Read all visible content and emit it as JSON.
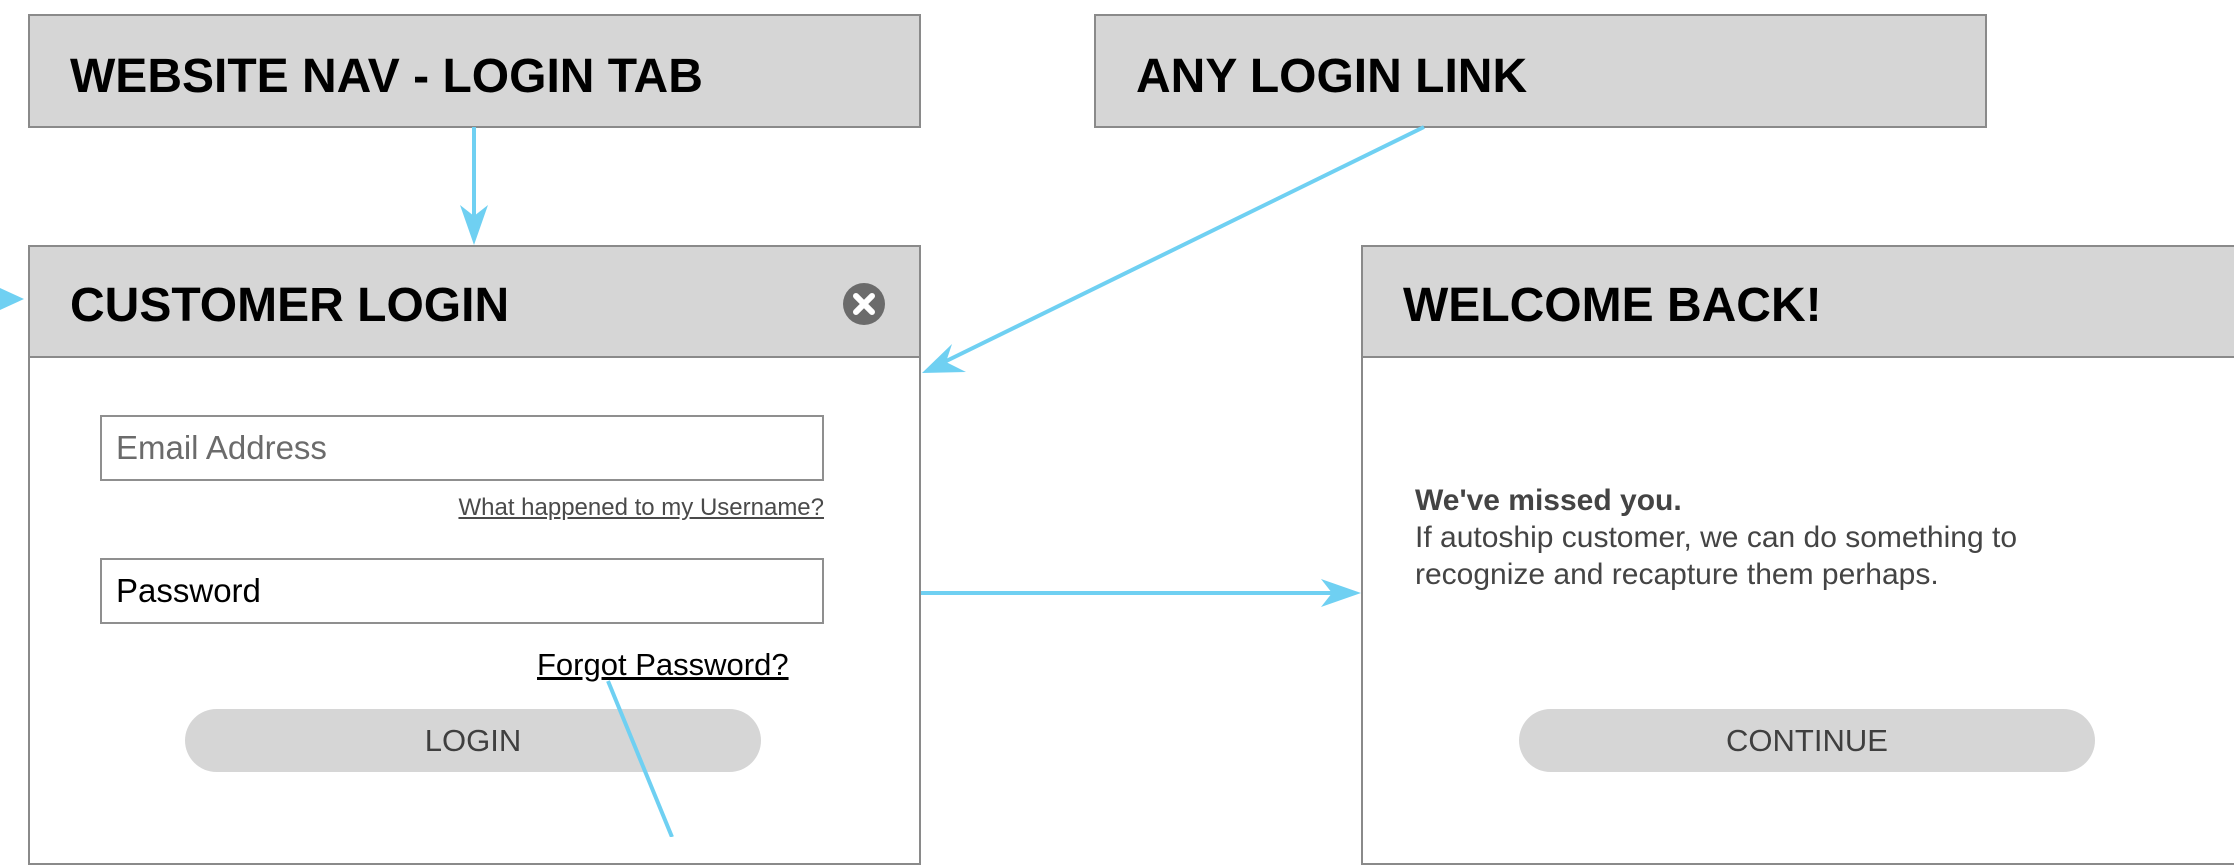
{
  "nav_box": {
    "title": "WEBSITE NAV - LOGIN TAB"
  },
  "link_box": {
    "title": "ANY LOGIN LINK"
  },
  "login_dialog": {
    "title": "CUSTOMER LOGIN",
    "close_icon": "close-icon",
    "email_placeholder": "Email Address",
    "username_help_link": "What happened to my Username?",
    "password_value": "Password",
    "forgot_password_link": "Forgot Password?",
    "login_button": "LOGIN"
  },
  "welcome_dialog": {
    "title": "WELCOME BACK!",
    "message_heading": "We've missed you.",
    "message_line_1": "If autoship customer, we can do something to",
    "message_line_2": "recognize and recapture them perhaps.",
    "continue_button": "CONTINUE"
  },
  "colors": {
    "connector": "#6fd0f2",
    "panel_header": "#d6d6d6",
    "border": "#8a8a8a"
  }
}
